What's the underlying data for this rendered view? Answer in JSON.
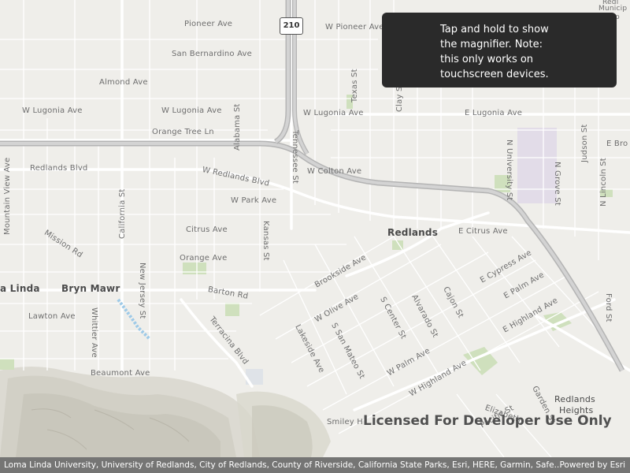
{
  "callout": {
    "lines": [
      "Tap and hold to show",
      "the magnifier. Note:",
      "this only works on",
      "touchscreen devices."
    ]
  },
  "license_text": "Licensed For Developer Use Only",
  "attribution": {
    "text": "Loma Linda University, University of Redlands, City of Redlands, County of Riverside, California State Parks, Esri, HERE, Garmin, Safe...",
    "powered": "Powered by Esri"
  },
  "shield": "210",
  "labels": {
    "pioneer": "Pioneer Ave",
    "w_pioneer": "W Pioneer Ave",
    "san_bernardino": "San Bernardino Ave",
    "almond": "Almond Ave",
    "w_lugonia1": "W Lugonia Ave",
    "w_lugonia2": "W Lugonia Ave",
    "e_lugonia": "E Lugonia Ave",
    "orange_tree": "Orange Tree Ln",
    "redlands_blvd": "Redlands Blvd",
    "w_redlands_blvd": "W Redlands Blvd",
    "w_colton": "W Colton Ave",
    "w_park": "W Park Ave",
    "citrus": "Citrus Ave",
    "e_citrus": "E Citrus Ave",
    "orange_ave": "Orange Ave",
    "barton": "Barton Rd",
    "lawton": "Lawton Ave",
    "beaumont": "Beaumont Ave",
    "mission": "Mission Rd",
    "mountain_view": "Mountain View Ave",
    "california": "California St",
    "new_jersey": "New Jersey St",
    "alabama": "Alabama St",
    "tennessee": "Tennessee St",
    "kansas": "Kansas St",
    "texas": "Texas St",
    "clay": "Clay St",
    "whittier": "Whittier Ave",
    "terracina": "Terracina Blvd",
    "brookside": "Brookside Ave",
    "w_olive": "W Olive Ave",
    "lakeside": "Lakeside Ave",
    "s_san_mateo": "S San Mateo St",
    "s_center": "S Center St",
    "alvarado": "Alvarado St",
    "cajon": "Cajon St",
    "w_palm": "W Palm Ave",
    "e_palm": "E Palm Ave",
    "e_cypress": "E Cypress Ave",
    "e_highland": "E Highland Ave",
    "w_highland": "W Highland Ave",
    "n_university": "N University St",
    "n_grove": "N Grove St",
    "judson": "Judson St",
    "n_lincoln": "N Lincoln St",
    "ford": "Ford St",
    "garden": "Garden St",
    "elizabeth": "Elizabeth",
    "pacific": "Pacific St",
    "smiley": "Smiley H",
    "e_bro": "E Bro",
    "redlands": "Redlands",
    "redlands_heights_1": "Redlands",
    "redlands_heights_2": "Heights",
    "bryn_mawr": "Bryn Mawr",
    "loma_linda": "a Linda",
    "municipal_1": "Redl",
    "municipal_2": "Municip",
    "municipal_3": "Airp"
  }
}
